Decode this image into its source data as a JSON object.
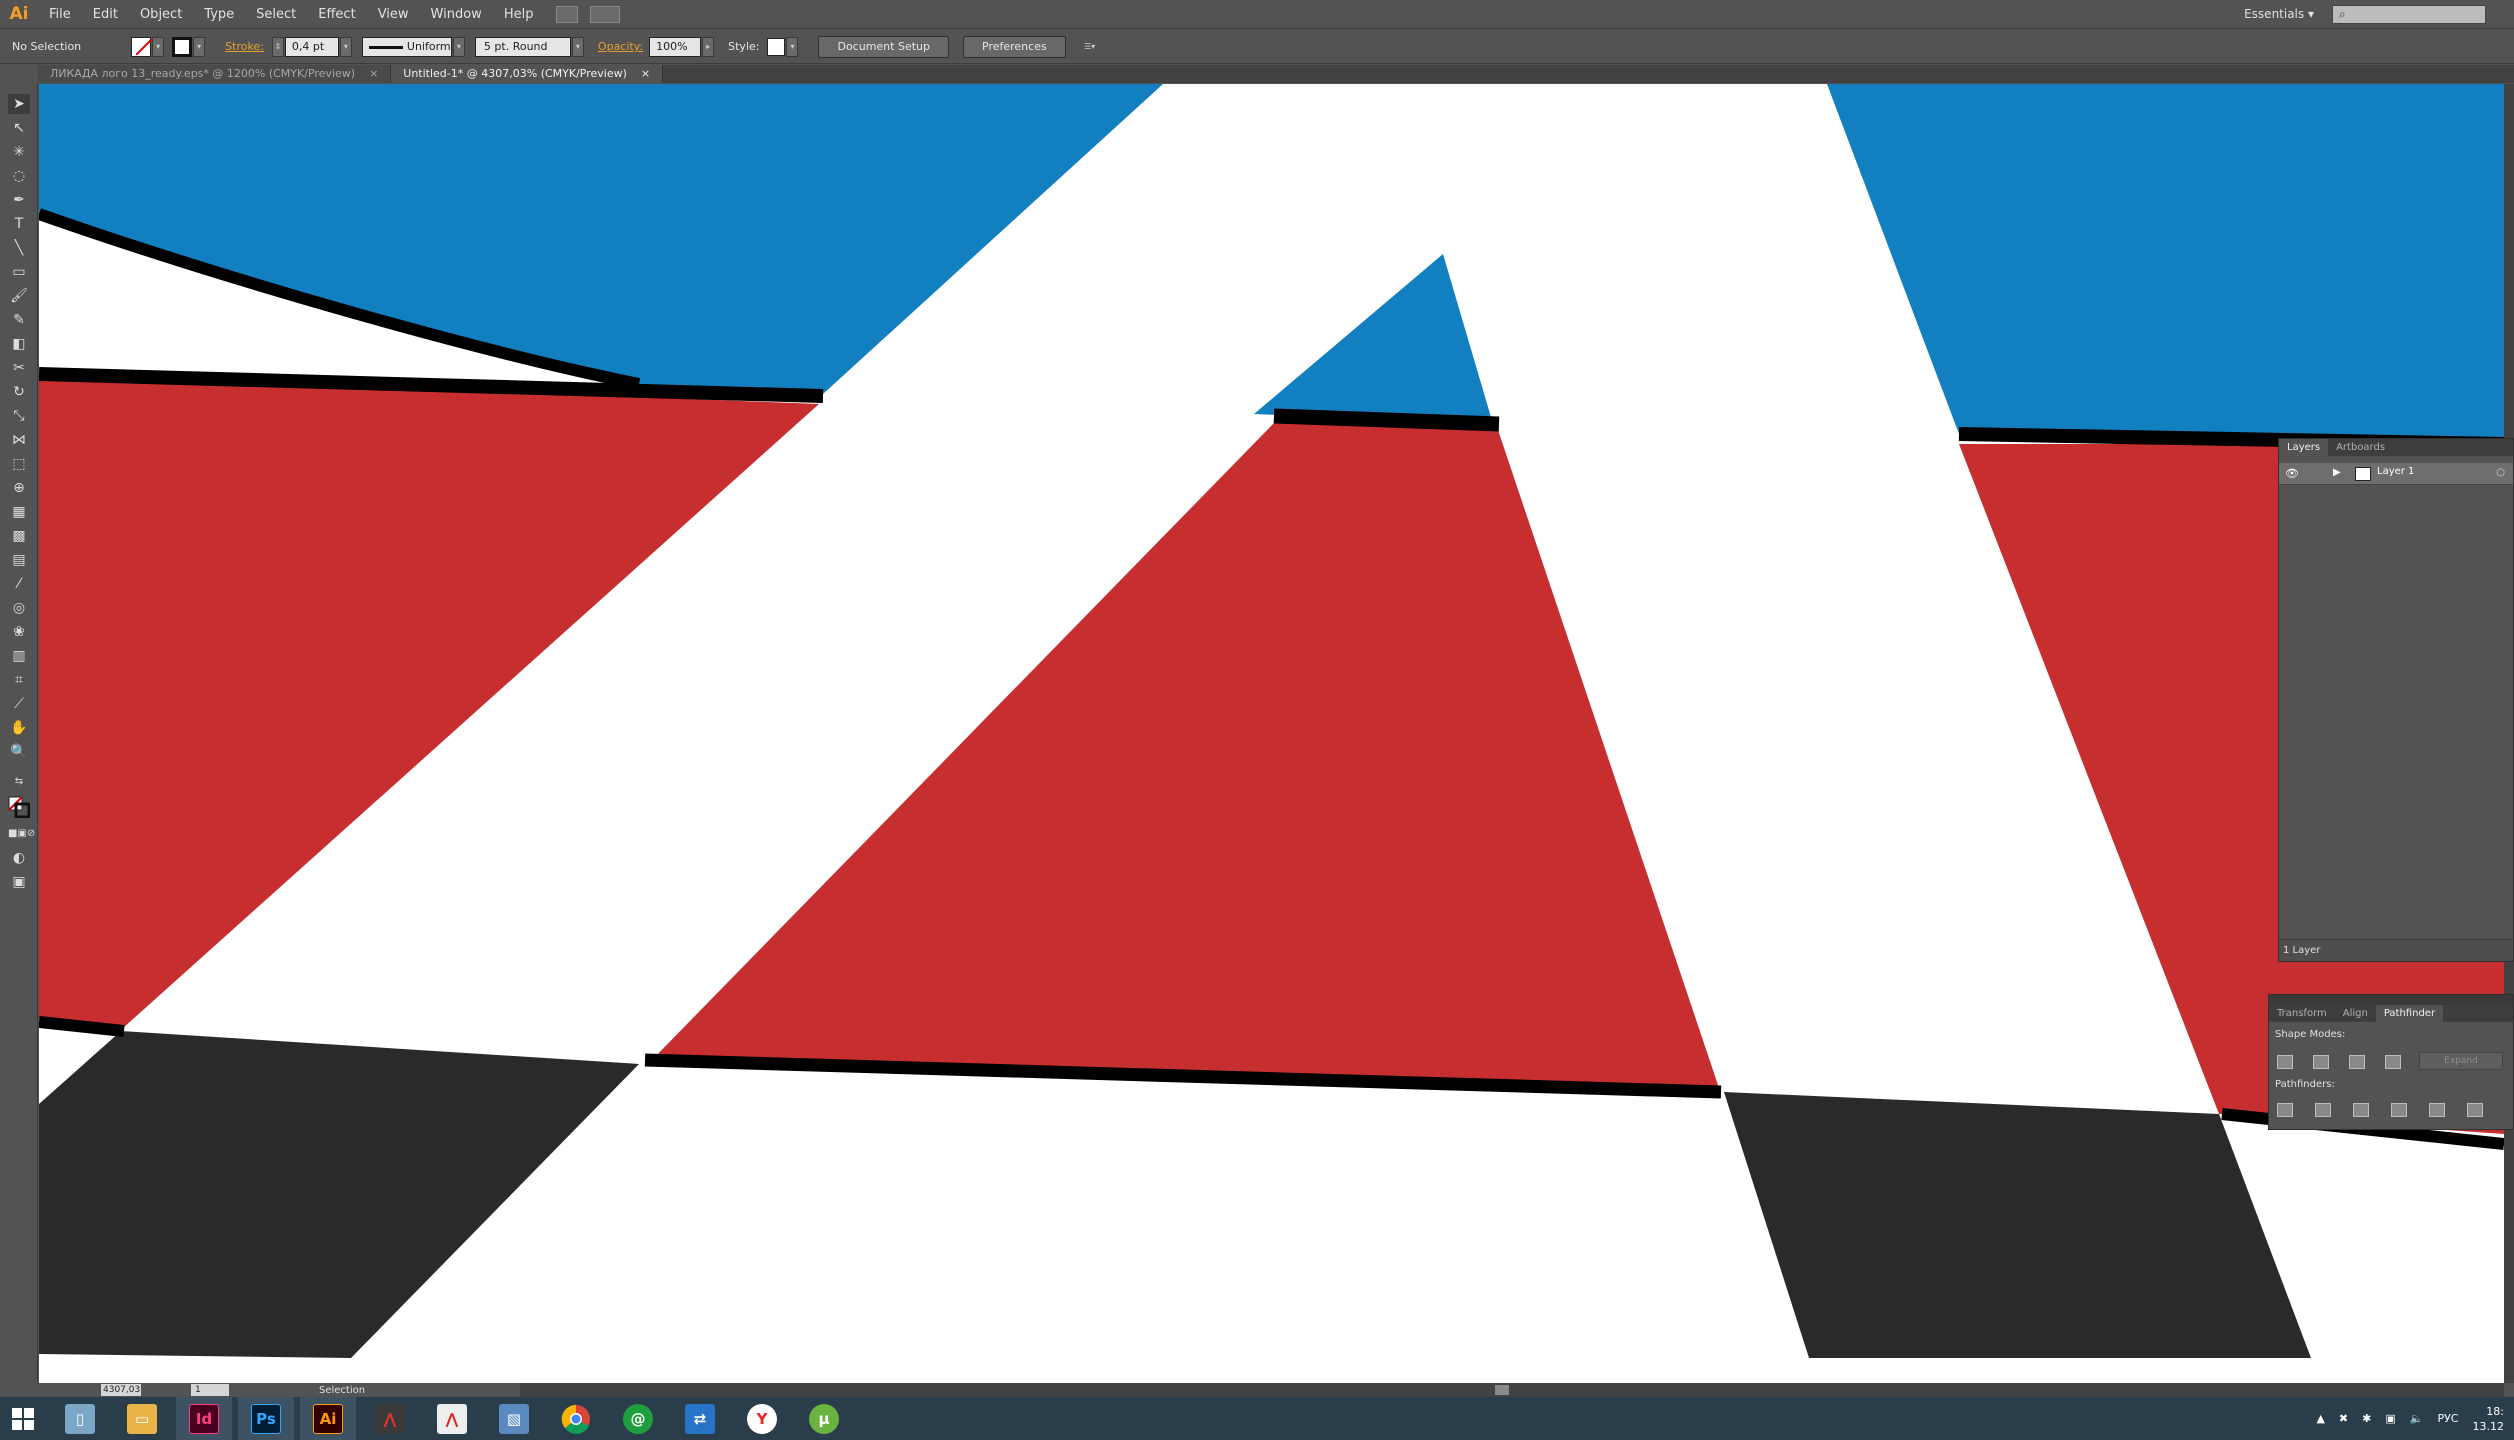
{
  "app": {
    "logo": "Ai",
    "workspace": "Essentials"
  },
  "menu": [
    "File",
    "Edit",
    "Object",
    "Type",
    "Select",
    "Effect",
    "View",
    "Window",
    "Help"
  ],
  "control": {
    "selection": "No Selection",
    "stroke_label": "Stroke:",
    "stroke_weight": "0,4 pt",
    "stroke_profile": "Uniform",
    "brush": "5 pt. Round",
    "opacity_label": "Opacity:",
    "opacity": "100%",
    "style_label": "Style:",
    "document_setup": "Document Setup",
    "preferences": "Preferences"
  },
  "tabs": [
    {
      "label": "ЛИКАДА лого 13_ready.eps* @ 1200% (CMYK/Preview)",
      "close": "×"
    },
    {
      "label": "Untitled-1* @ 4307,03% (CMYK/Preview)",
      "close": "×"
    }
  ],
  "status": {
    "zoom": "4307,03",
    "page": "1",
    "tool": "Selection"
  },
  "layers_panel": {
    "tabs": [
      "Layers",
      "Artboards"
    ],
    "layer_name": "Layer 1",
    "footer": "1 Layer"
  },
  "pathfinder_panel": {
    "tabs": [
      "Transform",
      "Align",
      "Pathfinder"
    ],
    "shape_modes": "Shape Modes:",
    "pathfinders": "Pathfinders:",
    "expand": "Expand"
  },
  "taskbar": {
    "apps": [
      {
        "label": "Id",
        "color": "#49021f",
        "fg": "#ff3d7f"
      },
      {
        "label": "Ps",
        "color": "#001d34",
        "fg": "#31a8ff"
      },
      {
        "label": "Ai",
        "color": "#330000",
        "fg": "#ff9a00"
      }
    ],
    "language": "РУС",
    "time": "18:",
    "date": "13.12"
  },
  "colors": {
    "blue": "#127fc1",
    "red": "#c72e30",
    "dark": "#2a2a2a",
    "outline": "#000000"
  }
}
